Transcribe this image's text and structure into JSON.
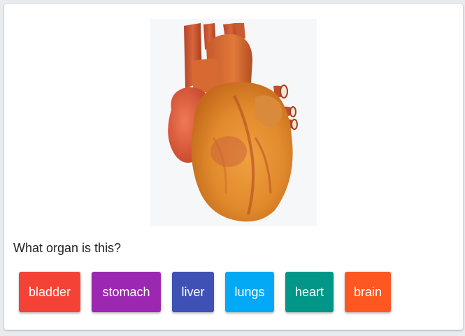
{
  "question": "What organ is this?",
  "image": {
    "icon": "heart-illustration"
  },
  "options": [
    {
      "label": "bladder",
      "color": "#f44336"
    },
    {
      "label": "stomach",
      "color": "#9c27b0"
    },
    {
      "label": "liver",
      "color": "#3f51b5"
    },
    {
      "label": "lungs",
      "color": "#03a9f4"
    },
    {
      "label": "heart",
      "color": "#009688"
    },
    {
      "label": "brain",
      "color": "#ff5722"
    }
  ]
}
